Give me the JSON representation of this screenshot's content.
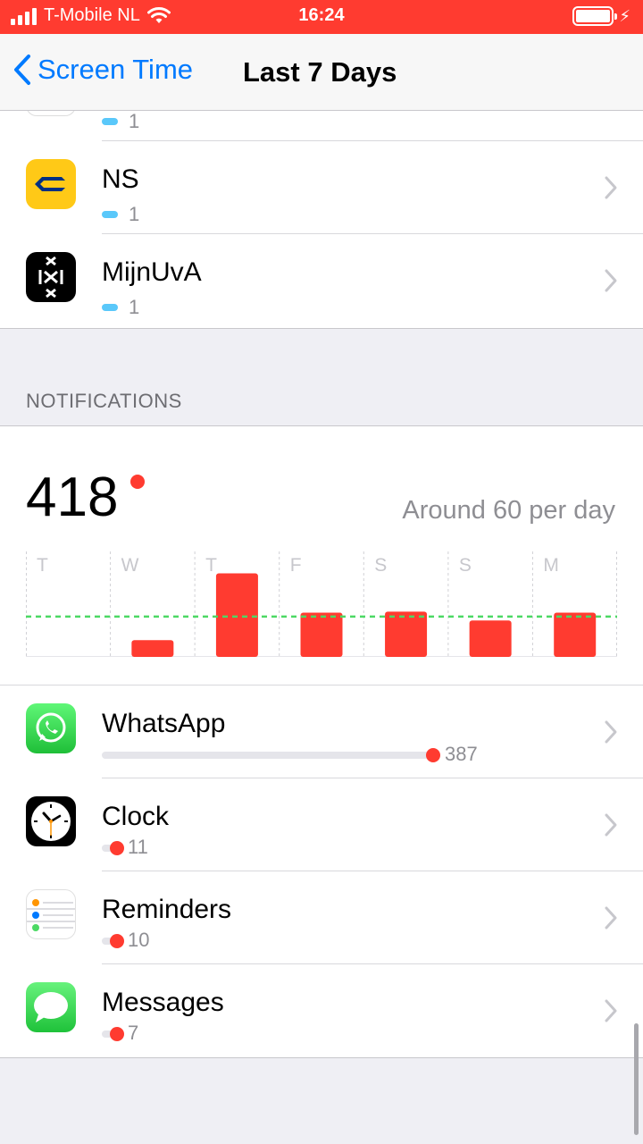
{
  "status_bar": {
    "carrier": "T-Mobile NL",
    "time": "16:24"
  },
  "nav": {
    "back_label": "Screen Time",
    "title": "Last 7 Days"
  },
  "usage_rows": [
    {
      "name": "",
      "value": "1",
      "icon": "partial-app-icon"
    },
    {
      "name": "NS",
      "value": "1",
      "icon": "ns-icon"
    },
    {
      "name": "MijnUvA",
      "value": "1",
      "icon": "mijnuva-icon"
    }
  ],
  "notifications": {
    "section_title": "NOTIFICATIONS",
    "total": "418",
    "average_text": "Around 60 per day"
  },
  "chart_data": {
    "type": "bar",
    "categories": [
      "T",
      "W",
      "T",
      "F",
      "S",
      "S",
      "M"
    ],
    "values": [
      0,
      17,
      85,
      45,
      46,
      37,
      45
    ],
    "average_line": 41,
    "ylim": [
      0,
      100
    ],
    "bar_color": "#ff3b30",
    "average_color": "#4cd964",
    "grid": true
  },
  "notification_rows": [
    {
      "name": "WhatsApp",
      "count": "387",
      "fraction": 1.0,
      "icon": "whatsapp-icon"
    },
    {
      "name": "Clock",
      "count": "11",
      "fraction": 0.028,
      "icon": "clock-icon"
    },
    {
      "name": "Reminders",
      "count": "10",
      "fraction": 0.026,
      "icon": "reminders-icon"
    },
    {
      "name": "Messages",
      "count": "7",
      "fraction": 0.018,
      "icon": "messages-icon"
    }
  ],
  "colors": {
    "accent": "#007aff",
    "status_bar": "#ff3b30",
    "usage_bar": "#5ac8fa"
  }
}
